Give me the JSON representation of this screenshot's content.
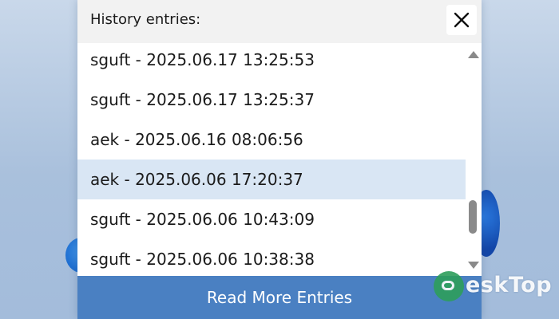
{
  "dialog": {
    "title": "History entries:",
    "close_icon": "close-icon",
    "read_more_label": "Read More Entries"
  },
  "history": {
    "selected_index": 3,
    "entries": [
      {
        "label": "sguft - 2025.06.17 13:25:53"
      },
      {
        "label": "sguft - 2025.06.17 13:25:37"
      },
      {
        "label": "aek - 2025.06.16 08:06:56"
      },
      {
        "label": "aek - 2025.06.06 17:20:37"
      },
      {
        "label": "sguft - 2025.06.06 10:43:09"
      },
      {
        "label": "sguft - 2025.06.06 10:38:38"
      }
    ]
  },
  "scrollbar": {
    "position_fraction": 0.85
  },
  "watermark": {
    "text": "eskTop",
    "logo_icon": "desktop-logo-icon"
  },
  "colors": {
    "header_bg": "#f2f2f2",
    "selected_row_bg": "#d9e6f4",
    "button_bg": "#4a80c2",
    "button_text": "#ffffff"
  }
}
